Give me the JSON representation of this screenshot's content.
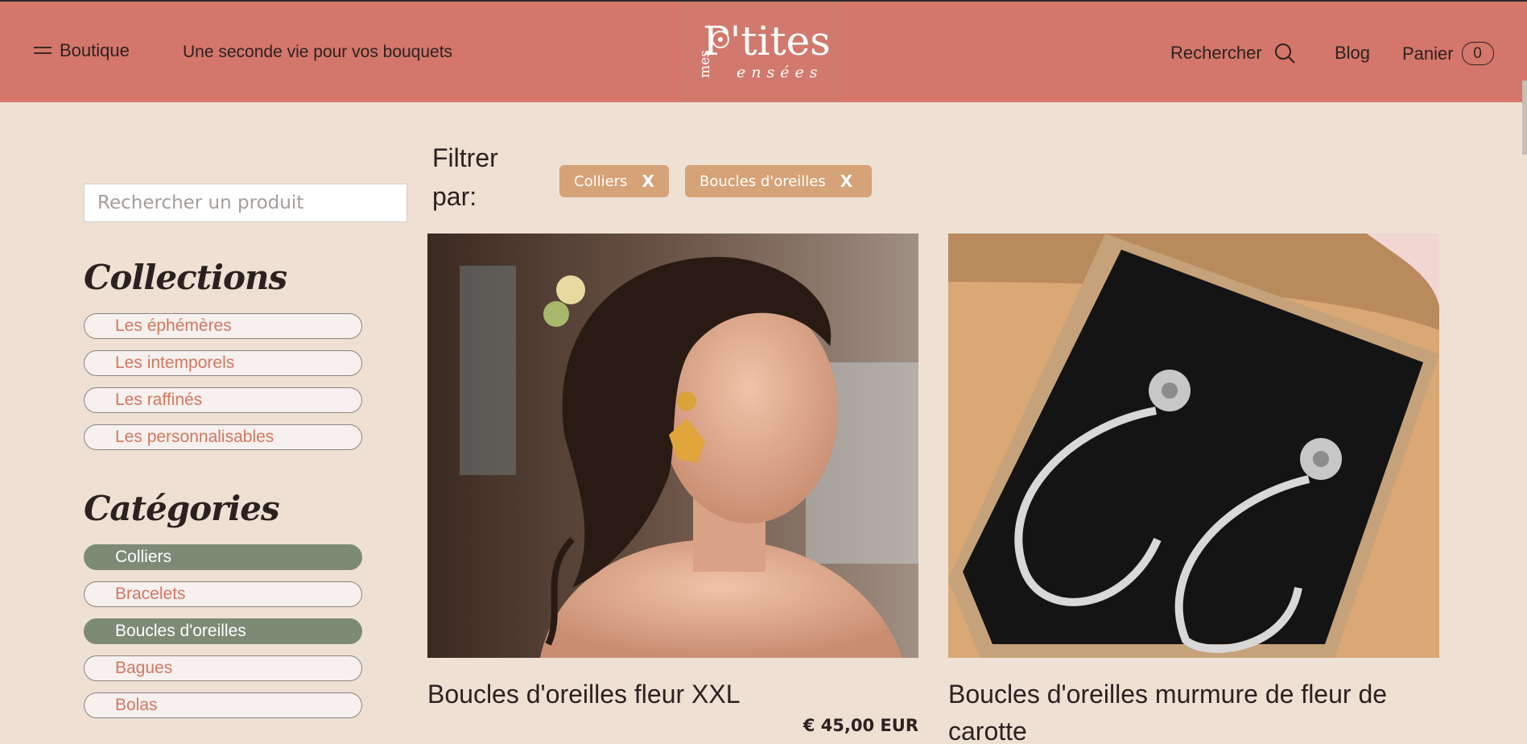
{
  "header": {
    "menu_label": "Boutique",
    "tagline": "Une seconde vie pour vos bouquets",
    "logo": {
      "small": "mes",
      "main": "P'tites",
      "sub": "ensées"
    },
    "search_label": "Rechercher",
    "blog_label": "Blog",
    "cart_label": "Panier",
    "cart_count": "0"
  },
  "sidebar": {
    "search_placeholder": "Rechercher un produit",
    "collections_title": "Collections",
    "collections": [
      {
        "label": "Les éphémères",
        "active": false
      },
      {
        "label": "Les intemporels",
        "active": false
      },
      {
        "label": "Les raffinés",
        "active": false
      },
      {
        "label": "Les personnalisables",
        "active": false
      }
    ],
    "categories_title": "Catégories",
    "categories": [
      {
        "label": "Colliers",
        "active": true
      },
      {
        "label": "Bracelets",
        "active": false
      },
      {
        "label": "Boucles d'oreilles",
        "active": true
      },
      {
        "label": "Bagues",
        "active": false
      },
      {
        "label": "Bolas",
        "active": false
      }
    ]
  },
  "filters": {
    "label": "Filtrer par:",
    "chips": [
      {
        "label": "Colliers",
        "remove": "X"
      },
      {
        "label": "Boucles d'oreilles",
        "remove": "X"
      }
    ]
  },
  "products": [
    {
      "title": "Boucles d'oreilles fleur XXL",
      "price": "€ 45,00 EUR"
    },
    {
      "title": "Boucles d'oreilles murmure de fleur de carotte",
      "price": ""
    }
  ],
  "colors": {
    "header_bg": "#d4766b",
    "page_bg": "#efe0d4",
    "active_pill": "#7c8a76",
    "pill_text": "#d3775e",
    "chip_bg": "#d6a277"
  },
  "icons": [
    "hamburger-icon",
    "search-icon",
    "remove-filter-icon"
  ]
}
